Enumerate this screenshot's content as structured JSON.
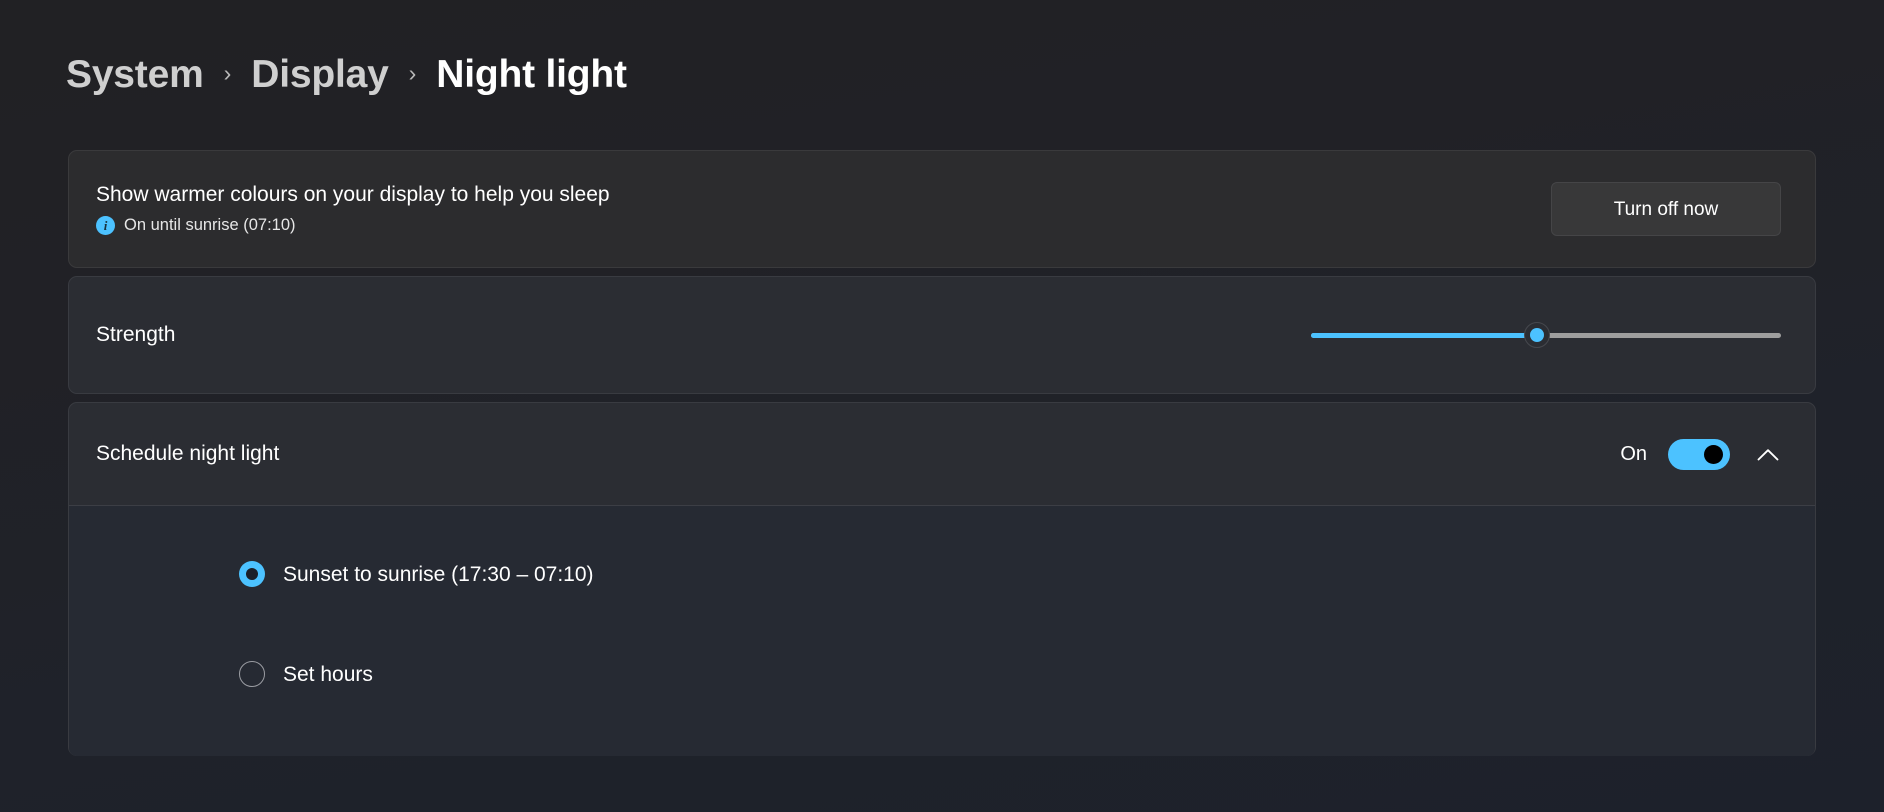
{
  "breadcrumb": {
    "items": [
      {
        "label": "System",
        "current": false
      },
      {
        "label": "Display",
        "current": false
      },
      {
        "label": "Night light",
        "current": true
      }
    ],
    "separator": "›"
  },
  "hero": {
    "title": "Show warmer colours on your display to help you sleep",
    "status_icon": "info-icon",
    "status_text": "On until sunrise (07:10)",
    "button_label": "Turn off now"
  },
  "strength": {
    "label": "Strength",
    "value_percent": 48,
    "min": 0,
    "max": 100,
    "fill_color": "#4cc2ff",
    "track_color": "#9e9e9e"
  },
  "schedule": {
    "title": "Schedule night light",
    "toggle_state": "On",
    "toggle_on": true,
    "expand_icon": "chevron-up-icon",
    "expanded": true,
    "options": [
      {
        "label": "Sunset to sunrise (17:30 – 07:10)",
        "selected": true
      },
      {
        "label": "Set hours",
        "selected": false
      }
    ]
  },
  "theme": {
    "accent": "#4cc2ff",
    "page_background": "#202024",
    "card_background": "#2c2c2e",
    "panel_background": "#262a33"
  }
}
